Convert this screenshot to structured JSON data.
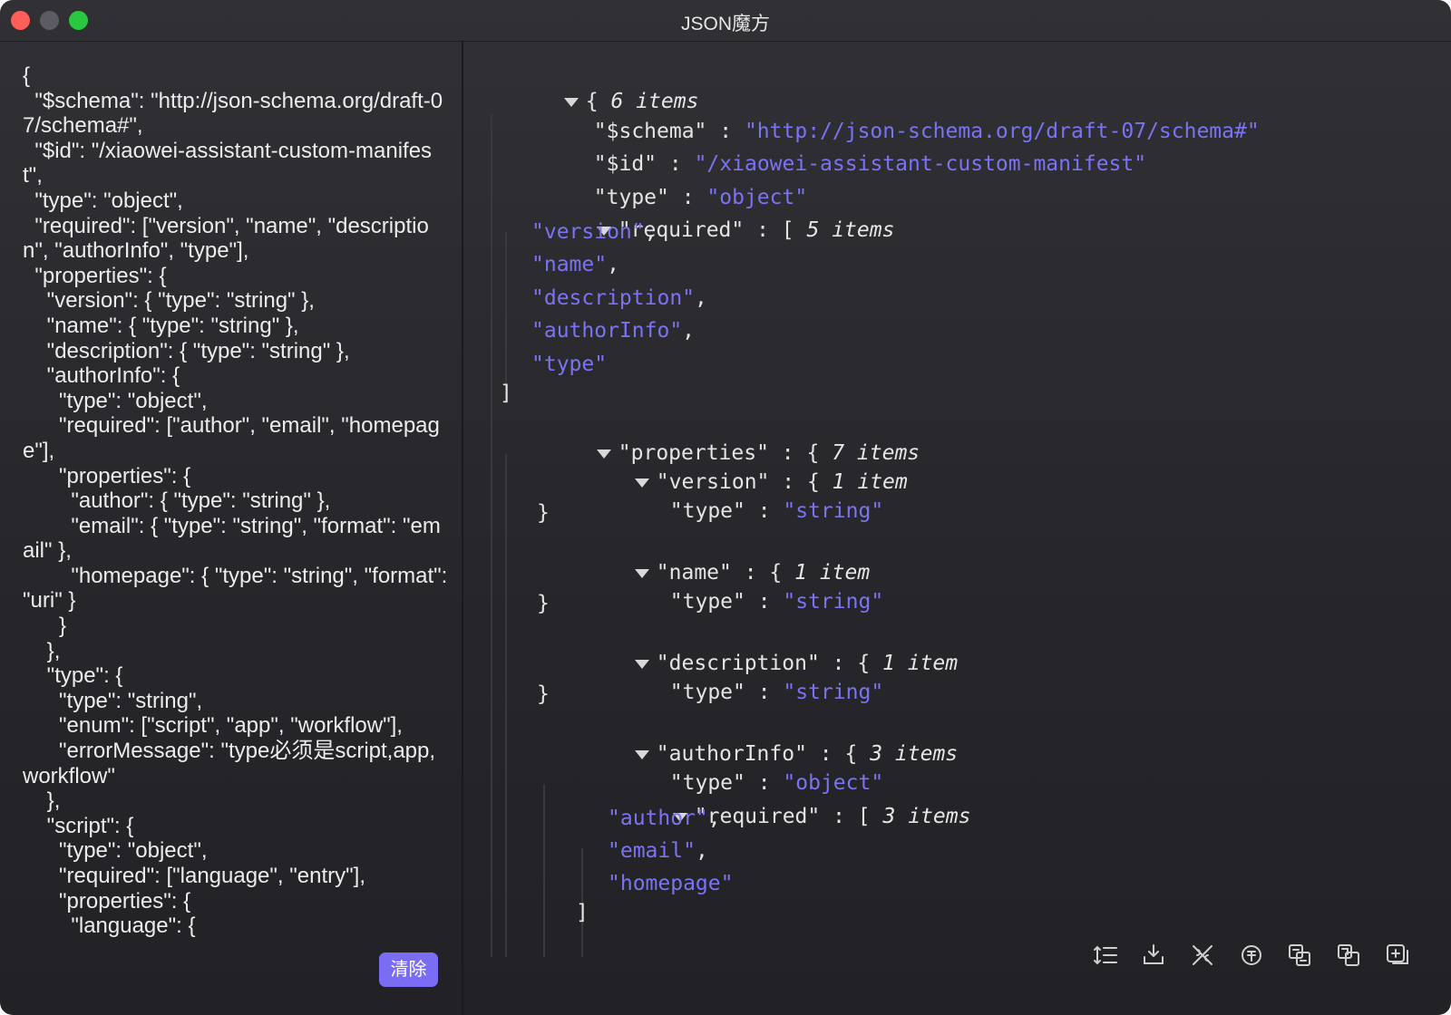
{
  "window": {
    "title": "JSON魔方"
  },
  "left": {
    "raw_json": "{\n  \"$schema\": \"http://json-schema.org/draft-07/schema#\",\n  \"$id\": \"/xiaowei-assistant-custom-manifest\",\n  \"type\": \"object\",\n  \"required\": [\"version\", \"name\", \"description\", \"authorInfo\", \"type\"],\n  \"properties\": {\n    \"version\": { \"type\": \"string\" },\n    \"name\": { \"type\": \"string\" },\n    \"description\": { \"type\": \"string\" },\n    \"authorInfo\": {\n      \"type\": \"object\",\n      \"required\": [\"author\", \"email\", \"homepage\"],\n      \"properties\": {\n        \"author\": { \"type\": \"string\" },\n        \"email\": { \"type\": \"string\", \"format\": \"email\" },\n        \"homepage\": { \"type\": \"string\", \"format\": \"uri\" }\n      }\n    },\n    \"type\": {\n      \"type\": \"string\",\n      \"enum\": [\"script\", \"app\", \"workflow\"],\n      \"errorMessage\": \"type必须是script,app,workflow\"\n    },\n    \"script\": {\n      \"type\": \"object\",\n      \"required\": [\"language\", \"entry\"],\n      \"properties\": {\n        \"language\": {",
    "clear_label": "清除"
  },
  "tree": {
    "root_meta": "6 items",
    "schema_key": "\"$schema\"",
    "schema_value": "\"http://json-schema.org/draft-07/schema#\"",
    "id_key": "\"$id\"",
    "id_value": "\"/xiaowei-assistant-custom-manifest\"",
    "type_key": "\"type\"",
    "type_value": "\"object\"",
    "required_key": "\"required\"",
    "required_meta": "5 items",
    "required_items": [
      "\"version\"",
      "\"name\"",
      "\"description\"",
      "\"authorInfo\"",
      "\"type\""
    ],
    "properties_key": "\"properties\"",
    "properties_meta": "7 items",
    "version_key": "\"version\"",
    "version_meta": "1 item",
    "version_type_value": "\"string\"",
    "name_key": "\"name\"",
    "name_meta": "1 item",
    "name_type_value": "\"string\"",
    "description_key": "\"description\"",
    "description_meta": "1 item",
    "description_type_value": "\"string\"",
    "authorinfo_key": "\"authorInfo\"",
    "authorinfo_meta": "3 items",
    "authorinfo_type_value": "\"object\"",
    "authorinfo_required_key": "\"required\"",
    "authorinfo_required_meta": "3 items",
    "authorinfo_required_items": [
      "\"author\"",
      "\"email\"",
      "\"homepage\""
    ]
  },
  "toolbar": {
    "icons": [
      "line-numbers-icon",
      "expand-icon",
      "remove-escape-icon",
      "escape-icon",
      "compress-icon",
      "copy-icon",
      "add-icon"
    ]
  }
}
